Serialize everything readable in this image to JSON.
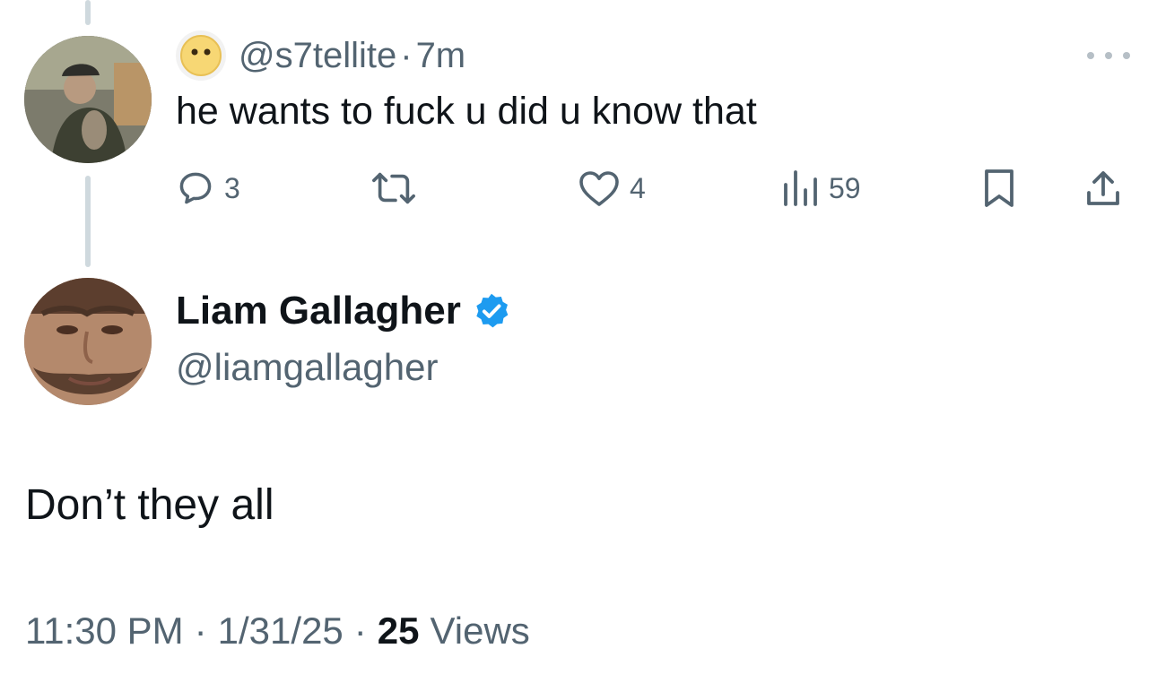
{
  "reply": {
    "emoji": "😶",
    "handle": "@s7tellite",
    "separator": "·",
    "time": "7m",
    "text": "he wants to fuck u did u know that",
    "metrics": {
      "replies": "3",
      "likes": "4",
      "views": "59"
    }
  },
  "main_tweet": {
    "name": "Liam Gallagher",
    "handle": "@liamgallagher",
    "text": "Don’t they all",
    "time": "11:30 PM",
    "date": "1/31/25",
    "separator": "·",
    "views_count": "25",
    "views_label": "Views"
  },
  "colors": {
    "text_primary": "#0f1419",
    "text_secondary": "#536471",
    "verified_blue": "#1d9bf0",
    "thread_line": "#cfd9de"
  },
  "icons": {
    "reply": "speech-bubble-icon",
    "retweet": "retweet-icon",
    "like": "heart-icon",
    "views": "bar-chart-icon",
    "bookmark": "bookmark-icon",
    "share": "share-icon",
    "more": "more-dots-icon",
    "verified": "verified-badge-icon"
  }
}
